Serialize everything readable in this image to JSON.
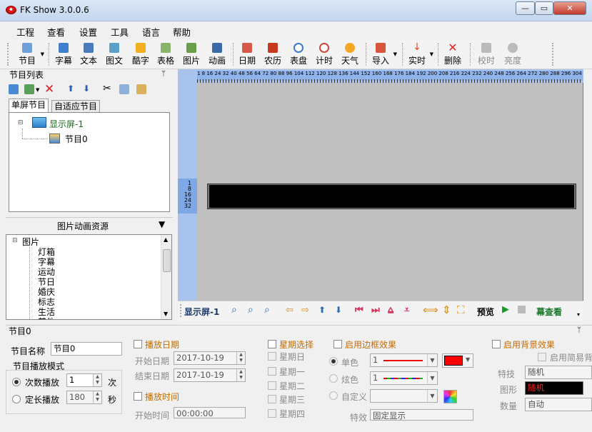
{
  "window": {
    "title": "FK Show 3.0.0.6",
    "minimize": "—",
    "maximize": "▭",
    "close": "✕"
  },
  "menu": [
    "工程",
    "查看",
    "设置",
    "工具",
    "语言",
    "帮助"
  ],
  "toolbar": {
    "program": "节目",
    "subtitle": "字幕",
    "text": "文本",
    "image_text": "图文",
    "cool_text": "酷字",
    "table": "表格",
    "image": "图片",
    "animation": "动画",
    "date": "日期",
    "lunar": "农历",
    "clock": "表盘",
    "timer": "计时",
    "weather": "天气",
    "import": "导入",
    "realtime": "实时",
    "delete": "删除",
    "calibrate": "校时",
    "brightness": "亮度"
  },
  "program_list": {
    "title": "节目列表",
    "pin": "ᛘ",
    "tabs": [
      "单屏节目",
      "自适应节目"
    ],
    "tree": {
      "screen": "显示屏-1",
      "program": "节目0"
    }
  },
  "resources": {
    "title": "图片动画资源",
    "root": "图片",
    "items": [
      "灯箱",
      "字幕",
      "运动",
      "节日",
      "婚庆",
      "标志",
      "生活",
      "其他"
    ]
  },
  "ruler": {
    "top_numbers": "1 8 16 24 32 40 48 56 64 72 80 88 96 104 112 120 128 136 144 152 160 168 176 184 192 200 208 216 224 232 240 248 256 264 272 280 288 296 304 312 320 328 336 344 352 360 368 376 384 392 400 408 416 424 432 440 448 456 464 472 480 488 496 504 512",
    "left_numbers": [
      "1",
      "8",
      "16",
      "24",
      "32"
    ]
  },
  "canvas_bar": {
    "screen": "显示屏-1",
    "preview": "预览",
    "curtain": "幕查看"
  },
  "props": {
    "title": "节目0",
    "pin": "ᛘ",
    "name_label": "节目名称",
    "name_value": "节目0",
    "mode_label": "节目播放模式",
    "count_label": "次数播放",
    "count_value": "1",
    "count_unit": "次",
    "fixed_label": "定长播放",
    "fixed_value": "180",
    "fixed_unit": "秒",
    "play_date": "播放日期",
    "start_date_label": "开始日期",
    "start_date": "2017-10-19",
    "end_date_label": "结束日期",
    "end_date": "2017-10-19",
    "play_time": "播放时间",
    "start_time_label": "开始时间",
    "start_time": "00:00:00",
    "week_select": "星期选择",
    "weekdays": [
      "星期日",
      "星期一",
      "星期二",
      "星期三",
      "星期四"
    ],
    "border_effect": "启用边框效果",
    "mono": "单色",
    "mono_value": "1",
    "flash": "炫色",
    "flash_value": "1",
    "custom": "自定义",
    "effect_label": "特效",
    "effect_value": "固定显示",
    "bg_effect": "启用背景效果",
    "simple_bg": "启用简易背",
    "fx_label": "特技",
    "fx_value": "随机",
    "shape_label": "图形",
    "shape_value": "随机",
    "count2_label": "数量",
    "count2_value": "自动",
    "border_color": "#ff0000"
  }
}
